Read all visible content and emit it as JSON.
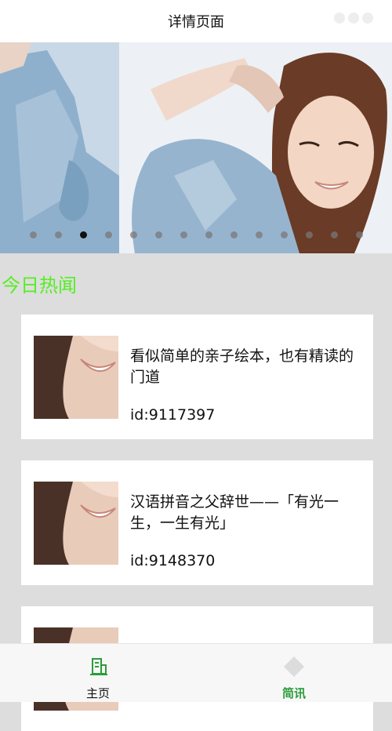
{
  "navbar": {
    "title": "详情页面"
  },
  "banner": {
    "dot_count": 14,
    "active_index": 2
  },
  "section": {
    "title": "今日热闻"
  },
  "news": [
    {
      "title": "看似简单的亲子绘本，也有精读的门道",
      "id": "id:9117397"
    },
    {
      "title": "汉语拼音之父辞世——「有光一生，一生有光」",
      "id": "id:9148370"
    },
    {
      "title": "",
      "id": ""
    }
  ],
  "tabbar": {
    "items": [
      {
        "label": "主页",
        "icon": "building-icon",
        "active": false
      },
      {
        "label": "简讯",
        "icon": "diamond-icon",
        "active": true
      }
    ]
  },
  "colors": {
    "accent_green": "#55ee22",
    "active_tab": "#2a9d3a",
    "background": "#dddddd"
  }
}
